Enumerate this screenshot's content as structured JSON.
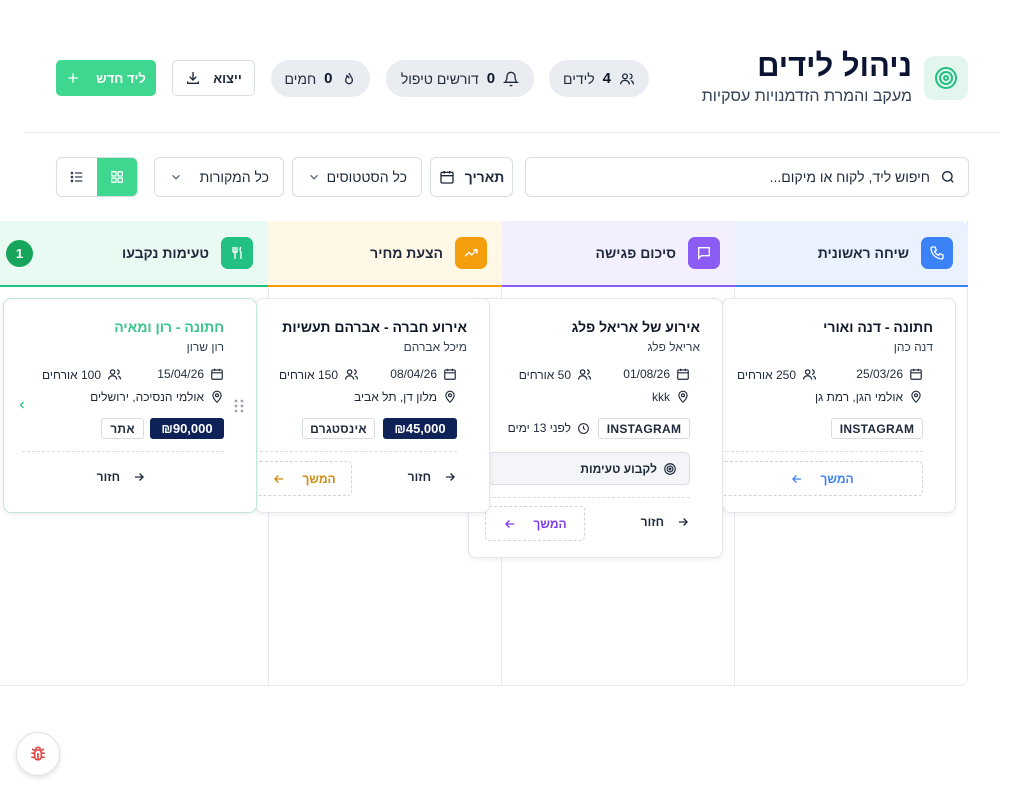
{
  "header": {
    "title": "ניהול לידים",
    "subtitle": "מעקב והמרת הזדמנויות עסקיות"
  },
  "stats": {
    "leads": {
      "count": "4",
      "label": "לידים",
      "icon": "users-icon"
    },
    "needs_attention": {
      "count": "0",
      "label": "דורשים טיפול",
      "icon": "bell-icon"
    },
    "hot": {
      "count": "0",
      "label": "חמים",
      "icon": "flame-icon"
    }
  },
  "actions": {
    "export_label": "ייצוא",
    "new_lead_label": "ליד חדש"
  },
  "filters": {
    "search_placeholder": "חיפוש ליד, לקוח או מיקום...",
    "date_label": "תאריך",
    "status_label": "כל הסטטוסים",
    "source_label": "כל המקורות"
  },
  "columns": [
    {
      "title": "שיחה ראשונית",
      "icon": "phone-icon",
      "color": "#3b82f6",
      "tint": "#eaf2ff"
    },
    {
      "title": "סיכום פגישה",
      "icon": "message-square-icon",
      "color": "#8b5cf6",
      "tint": "#f4efff"
    },
    {
      "title": "הצעת מחיר",
      "icon": "trending-up-icon",
      "color": "#f59e0b",
      "tint": "#fff8e6"
    },
    {
      "title": "טעימות נקבעו",
      "icon": "utensils-icon",
      "color": "#22c083",
      "tint": "#e9faf2",
      "count": "1"
    }
  ],
  "cards": {
    "c1": {
      "title": "חתונה - דנה ואורי",
      "client": "דנה כהן",
      "date": "25/03/26",
      "guests": "250 אורחים",
      "location": "אולמי הגן, רמת גן",
      "source": "INSTAGRAM",
      "continue_label": "המשך"
    },
    "c2": {
      "title": "אירוע של אריאל פלג",
      "client": "אריאל פלג",
      "date": "01/08/26",
      "guests": "50 אורחים",
      "location": "kkk",
      "source": "INSTAGRAM",
      "time_ago": "לפני 13 ימים",
      "schedule_label": "לקבוע טעימות",
      "back_label": "חזור",
      "continue_label": "המשך"
    },
    "c3": {
      "title": "אירוע חברה - אברהם תעשיות",
      "client": "מיכל אברהם",
      "date": "08/04/26",
      "guests": "150 אורחים",
      "location": "מלון דן, תל אביב",
      "source": "אינסטגרם",
      "price": "₪45,000",
      "back_label": "חזור",
      "continue_label": "המשך"
    },
    "c4": {
      "title": "חתונה - רון ומאיה",
      "client": "רון שרון",
      "date": "15/04/26",
      "guests": "100 אורחים",
      "location": "אולמי הנסיכה, ירושלים",
      "source": "אתר",
      "price": "₪90,000",
      "back_label": "חזור"
    }
  },
  "debug": {
    "icon": "bug-icon"
  }
}
